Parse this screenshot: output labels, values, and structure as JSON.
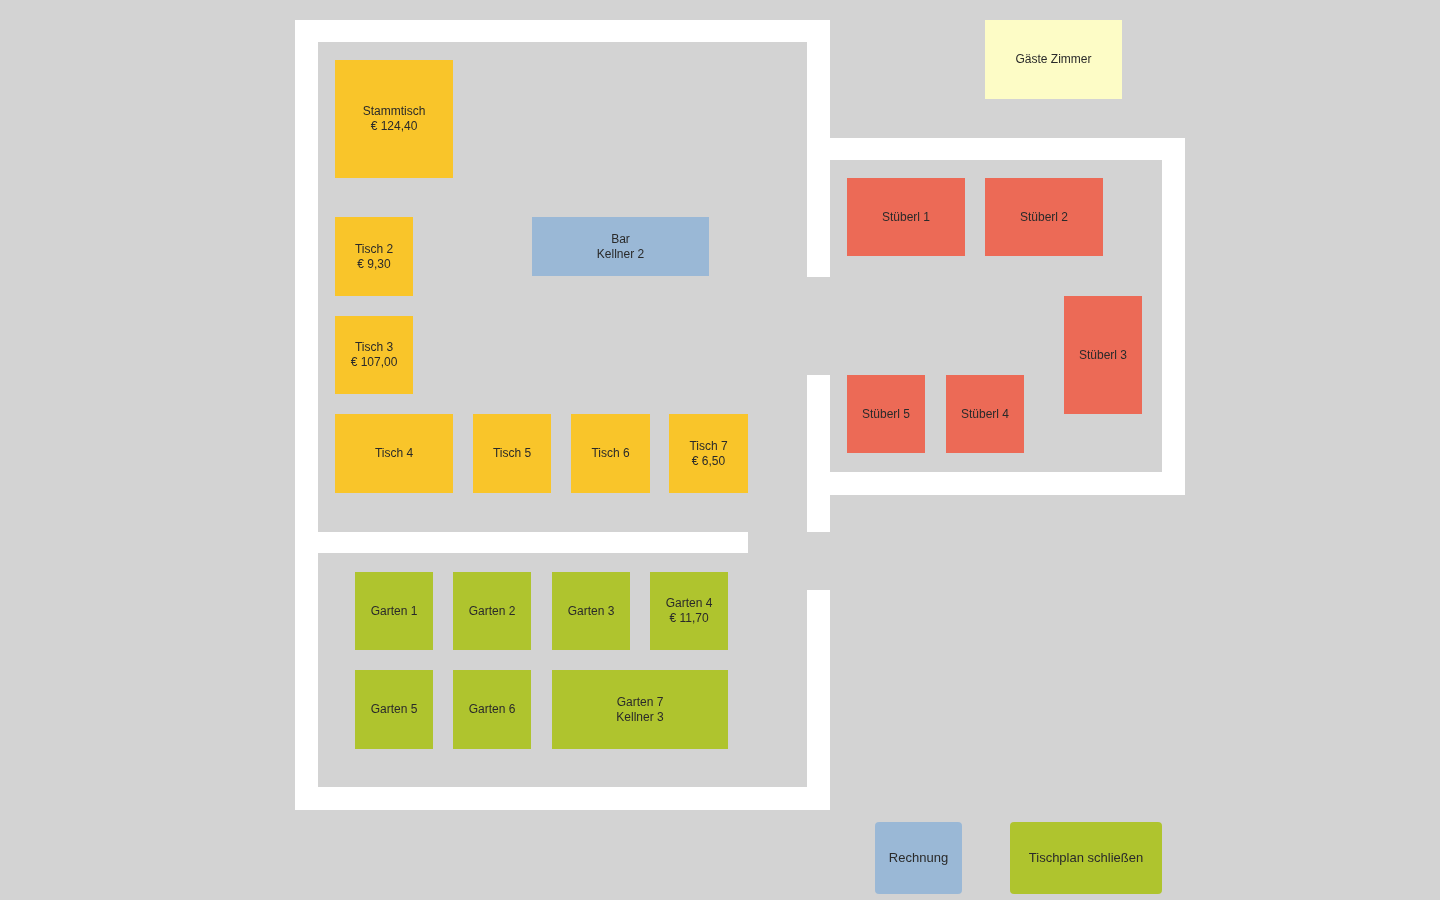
{
  "floor_plan": {
    "tables": [
      {
        "name": "Stammtisch",
        "detail": "€ 124,40",
        "color": "#f9c52a"
      },
      {
        "name": "Tisch 2",
        "detail": "€ 9,30",
        "color": "#f9c52a"
      },
      {
        "name": "Bar",
        "detail": "Kellner 2",
        "color": "#9ab8d6"
      },
      {
        "name": "Tisch 3",
        "detail": "€ 107,00",
        "color": "#f9c52a"
      },
      {
        "name": "Tisch 4",
        "color": "#f9c52a"
      },
      {
        "name": "Tisch 5",
        "color": "#f9c52a"
      },
      {
        "name": "Tisch 6",
        "color": "#f9c52a"
      },
      {
        "name": "Tisch 7",
        "detail": "€ 6,50",
        "color": "#f9c52a"
      },
      {
        "name": "Garten 1",
        "color": "#afc42e"
      },
      {
        "name": "Garten 2",
        "color": "#afc42e"
      },
      {
        "name": "Garten 3",
        "color": "#afc42e"
      },
      {
        "name": "Garten 4",
        "detail": "€ 11,70",
        "color": "#afc42e"
      },
      {
        "name": "Garten 5",
        "color": "#afc42e"
      },
      {
        "name": "Garten 6",
        "color": "#afc42e"
      },
      {
        "name": "Garten 7",
        "detail": "Kellner 3",
        "color": "#afc42e"
      },
      {
        "name": "Gäste Zimmer",
        "color": "#fdfcc6"
      },
      {
        "name": "Stüberl 1",
        "color": "#ec6a56"
      },
      {
        "name": "Stüberl 2",
        "color": "#ec6a56"
      },
      {
        "name": "Stüberl 3",
        "color": "#ec6a56"
      },
      {
        "name": "Stüberl 5",
        "color": "#ec6a56"
      },
      {
        "name": "Stüberl 4",
        "color": "#ec6a56"
      }
    ]
  },
  "buttons": [
    {
      "label": "Rechnung",
      "color": "#9ab8d6"
    },
    {
      "label": "Tischplan schließen",
      "color": "#afc42e"
    }
  ]
}
